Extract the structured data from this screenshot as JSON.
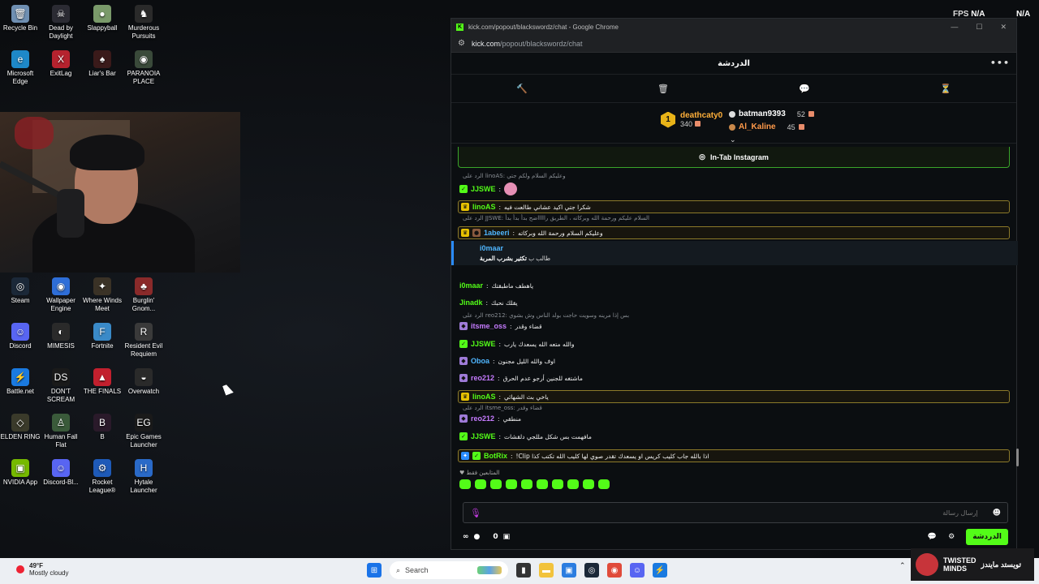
{
  "desktop": {
    "icons": [
      {
        "label": "Recycle Bin",
        "color": "#6f8fb2",
        "glyph": "🗑"
      },
      {
        "label": "Dead by Daylight",
        "color": "#2b2b33",
        "glyph": "☠"
      },
      {
        "label": "Slappyball",
        "color": "#7a9a6a",
        "glyph": "●"
      },
      {
        "label": "Murderous Pursuits",
        "color": "#2a2a2a",
        "glyph": "♞"
      },
      {
        "label": "Microsoft Edge",
        "color": "#1e88c8",
        "glyph": "e"
      },
      {
        "label": "ExitLag",
        "color": "#b5222e",
        "glyph": "X"
      },
      {
        "label": "Liar's Bar",
        "color": "#3a1a1a",
        "glyph": "♠"
      },
      {
        "label": "PARANOIA PLACE",
        "color": "#3a4a3a",
        "glyph": "◉"
      },
      {
        "label": "Steam",
        "color": "#1b2838",
        "glyph": "◎"
      },
      {
        "label": "Wallpaper Engine",
        "color": "#2e6ed8",
        "glyph": "◉"
      },
      {
        "label": "Where Winds Meet",
        "color": "#3a3226",
        "glyph": "✦"
      },
      {
        "label": "Burglin' Gnom...",
        "color": "#8a2a2a",
        "glyph": "♣"
      },
      {
        "label": "Discord",
        "color": "#5865f2",
        "glyph": "☺"
      },
      {
        "label": "MIMESIS",
        "color": "#2a2a2a",
        "glyph": "◐"
      },
      {
        "label": "Fortnite",
        "color": "#3a8ac8",
        "glyph": "F"
      },
      {
        "label": "Resident Evil Requiem",
        "color": "#3a3a3a",
        "glyph": "R"
      },
      {
        "label": "Battle.net",
        "color": "#1a7ae0",
        "glyph": "⚡"
      },
      {
        "label": "DON'T SCREAM",
        "color": "#1a1a1a",
        "glyph": "DS"
      },
      {
        "label": "THE FINALS",
        "color": "#c2202e",
        "glyph": "▲"
      },
      {
        "label": "Overwatch",
        "color": "#2a2a2a",
        "glyph": "◒"
      },
      {
        "label": "ELDEN RING",
        "color": "#3a3a2a",
        "glyph": "◇"
      },
      {
        "label": "Human Fall Flat",
        "color": "#3a5a3a",
        "glyph": "♙"
      },
      {
        "label": "B",
        "color": "#2a1a2a",
        "glyph": "B"
      },
      {
        "label": "Epic Games Launcher",
        "color": "#1a1a1a",
        "glyph": "EG"
      },
      {
        "label": "NVIDIA App",
        "color": "#76b900",
        "glyph": "▣"
      },
      {
        "label": "Discord-Bl...",
        "color": "#5865f2",
        "glyph": "☺"
      },
      {
        "label": "Rocket League®",
        "color": "#1e5ab8",
        "glyph": "⚙"
      },
      {
        "label": "Hytale Launcher",
        "color": "#2a6ac8",
        "glyph": "H"
      }
    ]
  },
  "overlay": {
    "fps_label": "FPS",
    "fps_value": "N/A",
    "right_value": "N/A"
  },
  "browser": {
    "title": "kick.com/popout/blackswordz/chat - Google Chrome",
    "url_host": "kick.com",
    "url_path": "/popout/blackswordz/chat"
  },
  "chat": {
    "header_title": "الدردشة",
    "leaderboard": {
      "top_rank": "1",
      "top_name": "deathcaty0",
      "top_count": "340",
      "rows": [
        {
          "name": "batman9393",
          "points": "52",
          "color": "#ffffff"
        },
        {
          "name": "Al_Kaline",
          "points": "45",
          "color": "#ff9a4a"
        }
      ]
    },
    "pinned": "In-Tab Instagram",
    "messages": [
      {
        "reply": "الرد على linoAS: وعليكم السلام ولكم جتي",
        "user": "JJSWE",
        "color": "#53fc18",
        "text": "",
        "badges": [
          "green"
        ],
        "emote": true
      },
      {
        "user": "linoAS",
        "color": "#53fc18",
        "text": "شكرا جتي اكيد عشاني طالعت فيه",
        "badges": [
          "crown"
        ],
        "hl": true
      },
      {
        "reply": "الرد على JJSWE: السلام عليكم ورحمة الله وبركاته ، الطريق راااااضح بدأ بدأ بدأ",
        "user": "1abeeri",
        "color": "#4fb6ff",
        "text": "وعليكم السلام ورحمة الله وبركاته",
        "badges": [
          "crown",
          "brown"
        ],
        "hl": true
      },
      {
        "user": "i0maar",
        "color": "#53fc18",
        "text": "ياهطف ماطبقتك",
        "badges": []
      },
      {
        "user": "Jinadk",
        "color": "#53fc18",
        "text": "يقلك نحبك",
        "badges": []
      },
      {
        "reply": "الرد على reo212: بس إذا مرينه وسويت حاجت بولد الناس وش بشوي",
        "user": "itsme_oss",
        "color": "#c67bff",
        "text": "قضاء وقدر",
        "badges": [
          "sub"
        ]
      },
      {
        "user": "JJSWE",
        "color": "#53fc18",
        "text": "والله متعه الله يسعدك يارب",
        "badges": [
          "green"
        ]
      },
      {
        "user": "Oboa",
        "color": "#4fb6ff",
        "text": "اوف والله الليل مجنون",
        "badges": [
          "sub"
        ]
      },
      {
        "user": "reo212",
        "color": "#c67bff",
        "text": "ماشتغه للجنين أرجو عدم الحرق",
        "badges": [
          "sub"
        ]
      },
      {
        "user": "linoAS",
        "color": "#53fc18",
        "text": "ياخي بث الشهائي",
        "badges": [
          "crown"
        ],
        "hl": true
      },
      {
        "reply": "الرد على itsme_oss: قضاء وقدر",
        "user": "reo212",
        "color": "#c67bff",
        "text": "منطقي",
        "badges": [
          "sub"
        ]
      },
      {
        "user": "JJSWE",
        "color": "#53fc18",
        "text": "مافهمت بس شكل مللجي دلقشات",
        "badges": [
          "green"
        ]
      },
      {
        "user": "BotRix",
        "color": "#53fc18",
        "text": "!Clip اذا بالله جاب كليب كريس او يسعدك تقدر صوي لها كليب الله تكتب كذا",
        "badges": [
          "blue",
          "green"
        ],
        "hl": true,
        "bot": true
      }
    ],
    "note": {
      "user": "i0maar",
      "text_prefix": "طالب ب",
      "text_bold": "تكثير بشرب المربة"
    },
    "emote_label": "المتابعين فقط",
    "emote_count": 10,
    "input_placeholder": "إرسال رسالة",
    "footer_count": "0",
    "send_label": "الدردشة"
  },
  "taskbar": {
    "temp": "49°F",
    "weather": "Mostly cloudy",
    "search_placeholder": "Search"
  },
  "branding": {
    "line1": "TWISTED",
    "line2": "MINDS",
    "arabic": "تويستد مايندز"
  }
}
